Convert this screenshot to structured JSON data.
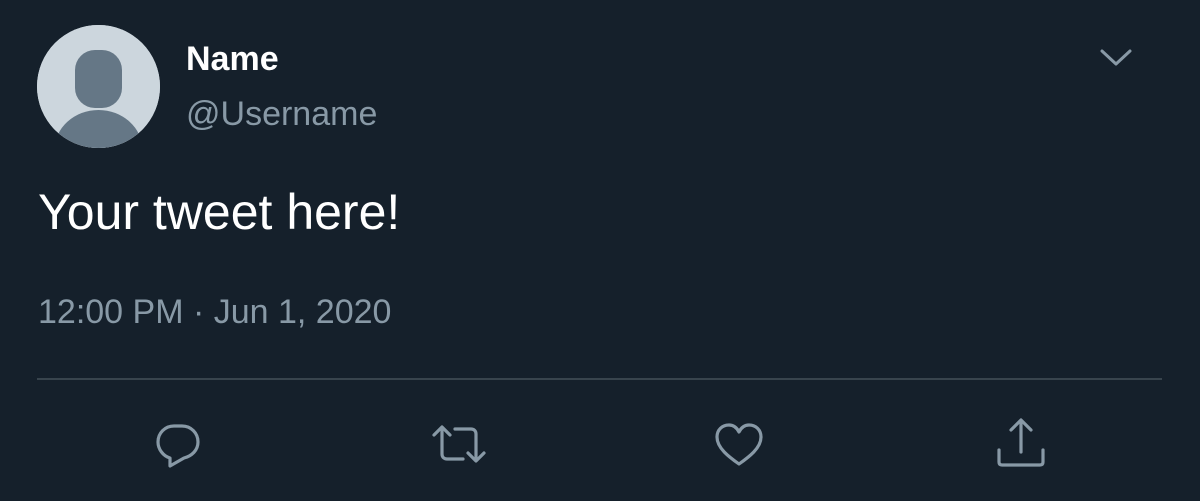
{
  "tweet": {
    "author": {
      "name": "Name",
      "username": "@Username"
    },
    "text": "Your tweet here!",
    "timestamp": "12:00 PM · Jun 1, 2020"
  },
  "icons": {
    "avatar": "default-avatar-icon",
    "menu": "chevron-down-icon",
    "reply": "reply-icon",
    "retweet": "retweet-icon",
    "like": "like-icon",
    "share": "share-icon"
  },
  "colors": {
    "background": "#15202b",
    "primary_text": "#ffffff",
    "secondary_text": "#8899a6",
    "divider": "#38444d",
    "avatar_bg": "#ccd6dd",
    "avatar_figure": "#657786"
  }
}
